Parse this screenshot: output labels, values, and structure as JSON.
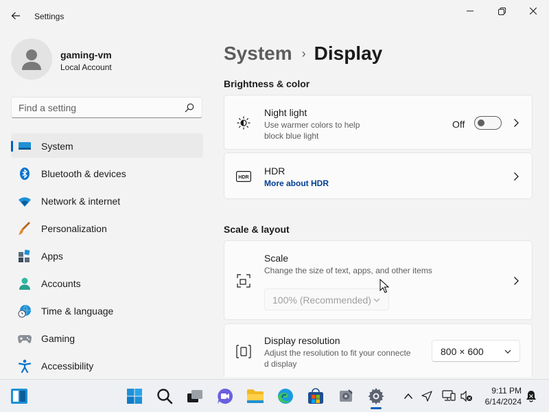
{
  "window": {
    "title": "Settings"
  },
  "profile": {
    "name": "gaming-vm",
    "account_type": "Local Account"
  },
  "search": {
    "placeholder": "Find a setting"
  },
  "sidebar": {
    "items": [
      {
        "label": "System",
        "icon": "system-icon",
        "active": true
      },
      {
        "label": "Bluetooth & devices",
        "icon": "bluetooth-icon"
      },
      {
        "label": "Network & internet",
        "icon": "wifi-icon"
      },
      {
        "label": "Personalization",
        "icon": "paintbrush-icon"
      },
      {
        "label": "Apps",
        "icon": "apps-icon"
      },
      {
        "label": "Accounts",
        "icon": "person-icon"
      },
      {
        "label": "Time & language",
        "icon": "globe-clock-icon"
      },
      {
        "label": "Gaming",
        "icon": "gamepad-icon"
      },
      {
        "label": "Accessibility",
        "icon": "accessibility-icon"
      }
    ]
  },
  "breadcrumb": {
    "parent": "System",
    "separator": "›",
    "current": "Display"
  },
  "sections": {
    "brightness_title": "Brightness & color",
    "scale_title": "Scale & layout"
  },
  "night_light": {
    "title": "Night light",
    "subtitle_line1": "Use warmer colors to help",
    "subtitle_line2": "block blue light",
    "state_label": "Off",
    "enabled": false
  },
  "hdr": {
    "title": "HDR",
    "link": "More about HDR"
  },
  "scale": {
    "title": "Scale",
    "subtitle": "Change the size of text, apps, and other items",
    "value": "100% (Recommended)"
  },
  "resolution": {
    "title": "Display resolution",
    "subtitle_line1": "Adjust the resolution to fit your connecte",
    "subtitle_line2": "d display",
    "value": "800 × 600"
  },
  "taskbar": {
    "apps": [
      "start-icon",
      "search-icon",
      "task-view-icon",
      "chat-icon",
      "file-explorer-icon",
      "edge-icon",
      "store-icon",
      "app-icon",
      "settings-icon"
    ],
    "active_app": "settings-icon"
  },
  "tray": {
    "time": "9:11 PM",
    "date": "6/14/2024"
  },
  "colors": {
    "accent": "#005fb8",
    "link": "#003e92",
    "background": "#f3f3f3",
    "card": "#fbfbfb"
  }
}
